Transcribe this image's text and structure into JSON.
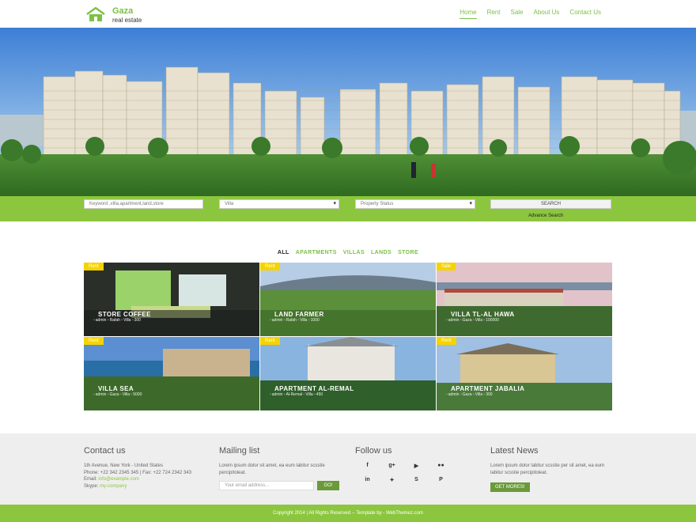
{
  "brand": {
    "name": "Gaza",
    "tagline": "real estate",
    "accent": "#7cc046",
    "green_bar": "#8cc63f"
  },
  "nav": [
    {
      "label": "Home",
      "active": true
    },
    {
      "label": "Rent"
    },
    {
      "label": "Sale"
    },
    {
      "label": "About Us"
    },
    {
      "label": "Contact Us"
    }
  ],
  "hero": {
    "slides": 3,
    "active_slide": 1
  },
  "search": {
    "keyword_placeholder": "Keyword ,villa,apartment,land,store",
    "type_value": "Villa",
    "status_value": "Property Status",
    "button": "SEARCH",
    "advance": "Advance Search"
  },
  "filters": [
    {
      "label": "ALL",
      "active": true
    },
    {
      "label": "APARTMENTS"
    },
    {
      "label": "VILLAS"
    },
    {
      "label": "LANDS"
    },
    {
      "label": "STORE"
    }
  ],
  "properties": [
    {
      "badge": "Rent",
      "title": "STORE COFFEE",
      "meta": [
        "admin",
        "Rafah",
        "Villa",
        "300"
      ]
    },
    {
      "badge": "Rent",
      "title": "LAND FARMER",
      "meta": [
        "admin",
        "Rafah",
        "Villa",
        "1000"
      ]
    },
    {
      "badge": "Sale",
      "title": "VILLA TL-AL HAWA",
      "meta": [
        "admin",
        "Gaza",
        "Villa",
        "100000"
      ]
    },
    {
      "badge": "Rent",
      "title": "VILLA SEA",
      "meta": [
        "admin",
        "Gaza",
        "Villa",
        "5000"
      ]
    },
    {
      "badge": "Rent",
      "title": "APARTMENT AL-REMAL",
      "meta": [
        "admin",
        "Al-Remal",
        "Villa",
        "450"
      ]
    },
    {
      "badge": "Rent",
      "title": "APARTMENT JABALIA",
      "meta": [
        "admin",
        "Gaza",
        "Villa",
        "300"
      ]
    }
  ],
  "footer": {
    "contact": {
      "title": "Contact us",
      "address": "1th Avenue, New York - United States",
      "phone": "Phone: +22 342 2345 345 | Fax: +22 724 2342 343",
      "email_label": "Email: ",
      "email": "info@example.com",
      "skype_label": "Skype: ",
      "skype": "my-company"
    },
    "mailing": {
      "title": "Mailing list",
      "text": "Lorem ipsum dolor sit amet, ea eum labitur scsstie percipitoleat.",
      "placeholder": "Your email address...",
      "button": "GO!"
    },
    "follow": {
      "title": "Follow us",
      "icons": [
        "facebook-icon",
        "google-plus-icon",
        "youtube-icon",
        "flickr-icon",
        "linkedin-icon",
        "twitter-icon",
        "skype-icon",
        "pinterest-icon"
      ],
      "glyphs": [
        "f",
        "g+",
        "▶",
        "●●",
        "in",
        "✦",
        "S",
        "P"
      ]
    },
    "news": {
      "title": "Latest News",
      "text": "Lorem ipsum dolor labitur scsstie per sit amet, ea eum labitur scsstie percipitoleat.",
      "button": "GET MORES!"
    }
  },
  "copyright": "Copyright 2014 | All Rights Reserved -- Template by - WebThemez.com"
}
